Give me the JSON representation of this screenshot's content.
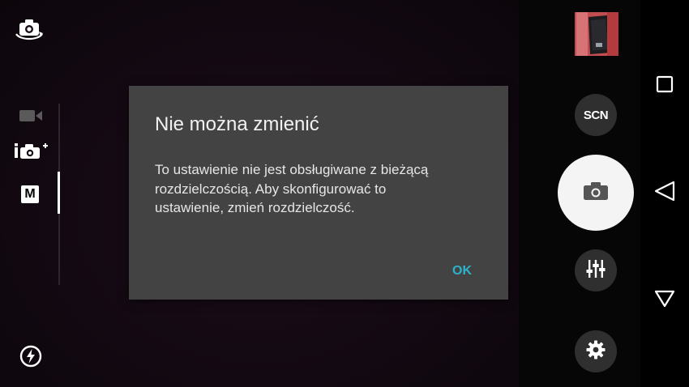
{
  "dialog": {
    "title": "Nie można zmienić",
    "message": "To ustawienie nie jest obsługiwane z bieżącą rozdzielczością. Aby skonfigurować to ustawienie, zmień rozdzielczość.",
    "ok_label": "OK"
  },
  "controls": {
    "scene_label": "SCN"
  },
  "modes": {
    "manual_label": "M",
    "selected": "M"
  },
  "icons": {
    "switch_camera": "switch-camera-icon",
    "video_mode": "video-camera-icon",
    "superior_auto": "superior-auto-icon",
    "manual_mode": "manual-mode-icon",
    "flash_auto": "flash-auto-icon",
    "thumbnail": "last-photo-thumbnail",
    "scene": "scene-selection",
    "shutter": "camera-shutter-icon",
    "adjustments": "sliders-icon",
    "settings": "gear-icon",
    "recents": "square-recents-icon",
    "back": "back-triangle-icon",
    "home": "down-triangle-icon"
  },
  "colors": {
    "dialog_background": "#434343",
    "ok_accent": "#2bb3cc",
    "shutter": "#f4f4f4",
    "round_button": "#2f2f2f"
  }
}
